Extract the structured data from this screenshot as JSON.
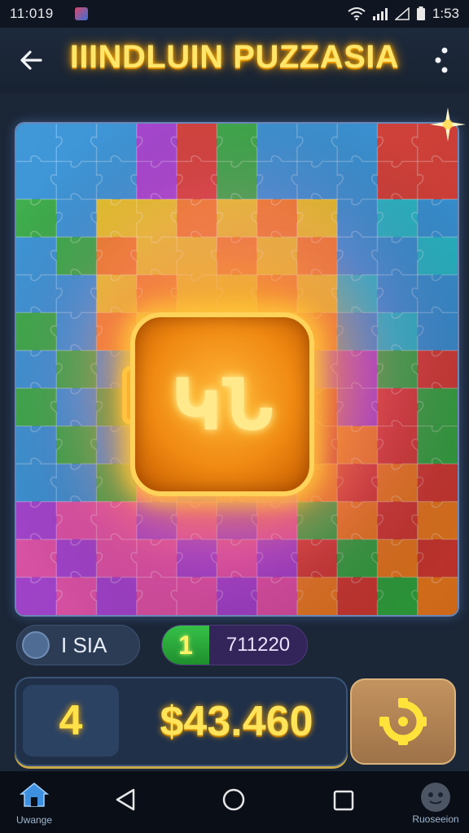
{
  "status_bar": {
    "time": "11:019",
    "clock": "1:53",
    "icons": [
      "notification-icon",
      "wifi-icon",
      "signal-icon",
      "battery-icon"
    ]
  },
  "header": {
    "title": "IIINDLUIN PUZZASIA",
    "back_icon": "arrow-left-icon",
    "menu_icon": "more-dots-icon"
  },
  "board": {
    "center_badge_text": "ԿՆ",
    "piece_colors": [
      "#e8c21a",
      "#2f8fd6",
      "#d6372f",
      "#2fa83e",
      "#a23ad0",
      "#f07a1c",
      "#1fb8c9",
      "#e14aa6"
    ]
  },
  "info": {
    "left_label": "I SIA",
    "level": "1",
    "score": "711220"
  },
  "panel": {
    "count": "4",
    "money": "$43.460",
    "action_icon": "puzzle-gear-icon"
  },
  "nav": {
    "home_label": "Uwange",
    "profile_label": "Ruoseeion"
  },
  "colors": {
    "background": "#1b2637",
    "accent_gold": "#ffe45a",
    "accent_green": "#2fa83e"
  }
}
